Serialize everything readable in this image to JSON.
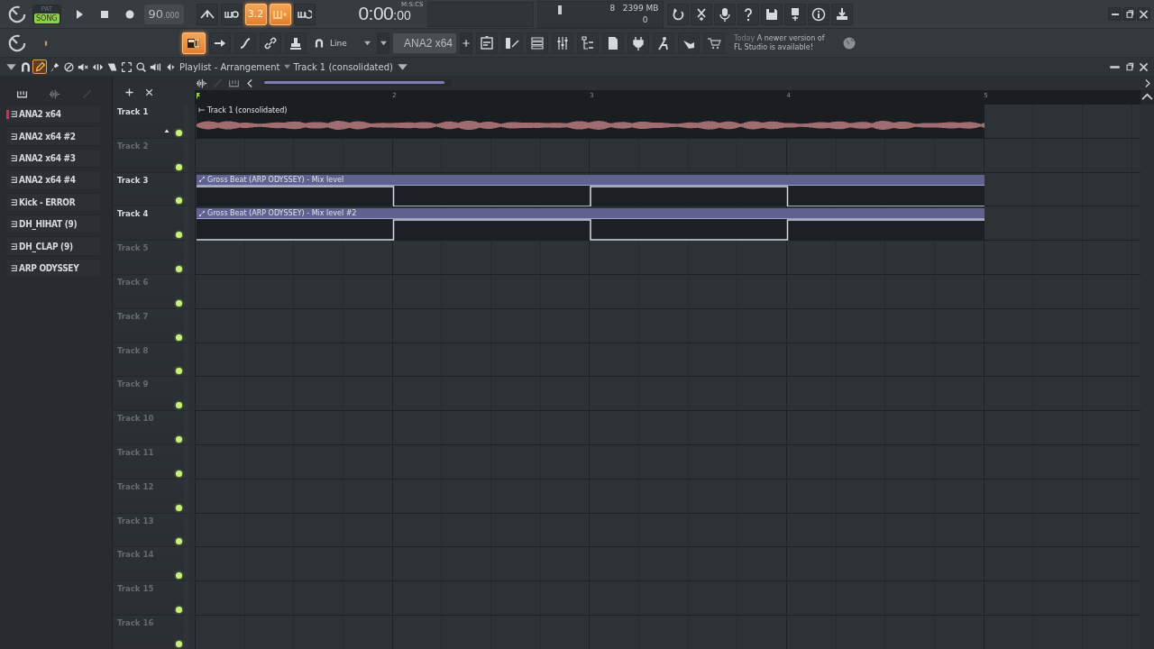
{
  "toolbar": {
    "pat_song": [
      {
        "label": "PAT",
        "selected": false
      },
      {
        "label": "SONG",
        "selected": true
      }
    ],
    "tempo": "90",
    "tempo_fraction": ".000",
    "time": "0:00",
    "time_centis": ":00",
    "time_format": "M:S:CS",
    "cpu": "8",
    "memory": "2399 MB",
    "polyphony": "0",
    "toggles": [
      {
        "kind": "metronome",
        "on": false
      },
      {
        "kind": "wait",
        "on": false
      },
      {
        "kind": "countdown",
        "label": "3.2",
        "on": true
      },
      {
        "kind": "step",
        "on": true
      },
      {
        "kind": "loop",
        "on": false
      }
    ],
    "snap_toggle": {
      "on": true
    },
    "snap": "Line",
    "channel": "ANA2 x64",
    "news": {
      "date": "Today",
      "message": "A newer version of FL Studio is available!"
    }
  },
  "playlist": {
    "title": "Playlist - Arrangement",
    "pattern": "Track 1 (consolidated)",
    "ruler": [
      "2",
      "3",
      "4",
      "5"
    ],
    "channels": [
      {
        "name": "ANA2 x64",
        "selected": true
      },
      {
        "name": "ANA2 x64 #2",
        "selected": false
      },
      {
        "name": "ANA2 x64 #3",
        "selected": false
      },
      {
        "name": "ANA2 x64 #4",
        "selected": false
      },
      {
        "name": "Kick - ERROR",
        "selected": false
      },
      {
        "name": "DH_HIHAT (9)",
        "selected": false
      },
      {
        "name": "DH_CLAP (9)",
        "selected": false
      },
      {
        "name": "ARP ODYSSEY",
        "selected": false
      }
    ],
    "tracks": [
      {
        "name": "Track 1",
        "dimmed": false,
        "clip": {
          "kind": "audio",
          "label": "Track 1 (consolidated)"
        }
      },
      {
        "name": "Track 2",
        "dimmed": true
      },
      {
        "name": "Track 3",
        "dimmed": false,
        "clip": {
          "kind": "automation",
          "label": "Gross Beat (ARP ODYSSEY) - Mix level",
          "start_high": true
        }
      },
      {
        "name": "Track 4",
        "dimmed": false,
        "clip": {
          "kind": "automation",
          "label": "Gross Beat (ARP ODYSSEY) - Mix level #2",
          "start_high": false
        }
      },
      {
        "name": "Track 5",
        "dimmed": true
      },
      {
        "name": "Track 6",
        "dimmed": true
      },
      {
        "name": "Track 7",
        "dimmed": true
      },
      {
        "name": "Track 8",
        "dimmed": true
      },
      {
        "name": "Track 9",
        "dimmed": true
      },
      {
        "name": "Track 10",
        "dimmed": true
      },
      {
        "name": "Track 11",
        "dimmed": true
      },
      {
        "name": "Track 12",
        "dimmed": true
      },
      {
        "name": "Track 13",
        "dimmed": true
      },
      {
        "name": "Track 14",
        "dimmed": true
      },
      {
        "name": "Track 15",
        "dimmed": true
      },
      {
        "name": "Track 16",
        "dimmed": true
      }
    ]
  }
}
